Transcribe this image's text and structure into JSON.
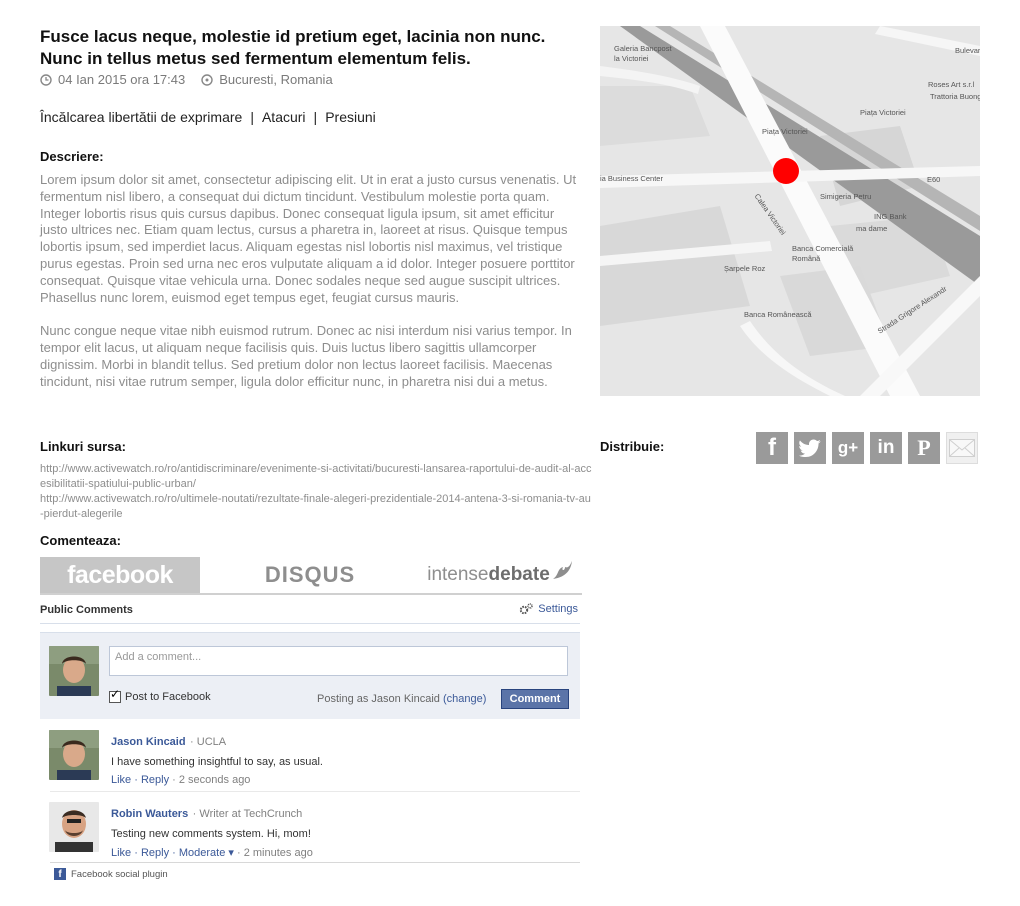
{
  "article": {
    "title": "Fusce lacus neque, molestie id pretium eget, lacinia non nunc. Nunc in tellus metus sed fermentum elementum felis.",
    "date": "04 Ian 2015 ora 17:43",
    "location": "Bucuresti, Romania",
    "tags": [
      "Încălcarea libertătii de exprimare",
      "Atacuri",
      "Presiuni"
    ],
    "description_label": "Descriere:",
    "paragraphs": [
      "Lorem ipsum dolor sit amet, consectetur adipiscing elit. Ut in erat a justo cursus venenatis. Ut fermentum nisl libero, a consequat dui dictum tincidunt. Vestibulum molestie porta quam. Integer lobortis risus quis cursus dapibus. Donec consequat ligula ipsum, sit amet efficitur justo ultrices nec. Etiam quam lectus, cursus a pharetra in, laoreet at risus. Quisque tempus lobortis ipsum, sed imperdiet lacus. Aliquam egestas nisl lobortis nisl maximus, vel tristique purus egestas. Proin sed urna nec eros vulputate aliquam a id dolor. Integer posuere porttitor consequat. Quisque vitae vehicula urna. Donec sodales neque sed augue suscipit ultrices. Phasellus nunc lorem, euismod eget tempus eget, feugiat cursus mauris.",
      "Nunc congue neque vitae nibh euismod rutrum. Donec ac nisi interdum nisi varius tempor. In tempor elit lacus, ut aliquam neque facilisis quis. Duis luctus libero sagittis ullamcorper dignissim. Morbi in blandit tellus. Sed pretium dolor non lectus laoreet facilisis. Maecenas tincidunt, nisi vitae rutrum semper, ligula dolor efficitur nunc, in pharetra nisi dui a metus."
    ],
    "links_label": "Linkuri sursa:",
    "links": [
      "http://www.activewatch.ro/ro/antidiscriminare/evenimente-si-activitati/bucuresti-lansarea-raportului-de-audit-al-accesibilitatii-spatiului-public-urban/",
      "http://www.activewatch.ro/ro/ultimele-noutati/rezultate-finale-alegeri-prezidentiale-2014-antena-3-si-romania-tv-au-pierdut-alegerile"
    ],
    "comment_label": "Comenteaza:"
  },
  "comment_tabs": {
    "facebook": "facebook",
    "disqus": "DISQUS",
    "intense_a": "intense",
    "intense_b": "debate"
  },
  "fb": {
    "public_comments": "Public Comments",
    "settings": "Settings",
    "placeholder": "Add a comment...",
    "post_to_facebook": "Post to Facebook",
    "posting_as": "Posting as Jason Kincaid",
    "change": "(change)",
    "comment_button": "Comment",
    "comments": [
      {
        "name": "Jason Kincaid",
        "affiliation": "· UCLA",
        "text": "I have something insightful to say, as usual.",
        "like": "Like",
        "reply": "Reply",
        "time": "· 2 seconds ago"
      },
      {
        "name": "Robin Wauters",
        "affiliation": "· Writer at TechCrunch",
        "text": "Testing new comments system. Hi, mom!",
        "like": "Like",
        "reply": "Reply",
        "moderate": "Moderate ▾",
        "time": "· 2 minutes ago"
      }
    ],
    "footer": "Facebook social plugin"
  },
  "map": {
    "labels": [
      "Galeria Bancpost",
      "la Victoriei",
      "Bulevar",
      "Roses Art s.r.l",
      "Trattoria Buongior",
      "Piața Victoriei",
      "Piața Victoriei",
      "ia Business Center",
      "Calea Victoriei",
      "Simigeria Petru",
      "ING Bank",
      "ma dame",
      "E60",
      "Banca Comercială",
      "Română",
      "Șarpele Roz",
      "Banca Românească",
      "Strada Grigore Alexandr"
    ],
    "marker_color": "#ff0000"
  },
  "share": {
    "label": "Distribuie:",
    "icons": [
      "facebook-icon",
      "twitter-icon",
      "google-plus-icon",
      "linkedin-icon",
      "pinterest-icon",
      "mail-icon"
    ]
  }
}
